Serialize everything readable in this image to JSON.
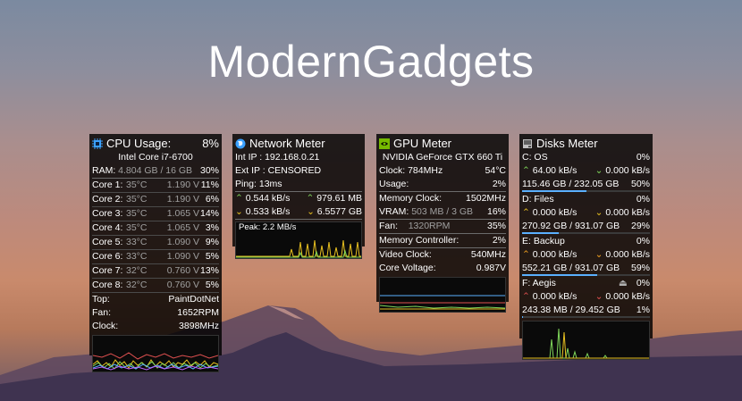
{
  "title": "ModernGadgets",
  "cpu": {
    "header": "CPU Usage:",
    "usage": "8%",
    "model": "Intel Core i7-6700",
    "ram_label": "RAM:",
    "ram_value": "4.804 GB / 16 GB",
    "ram_pct": "30%",
    "cores": [
      {
        "name": "Core 1:",
        "temp": "35°C",
        "volt": "1.190 V",
        "pct": "11%"
      },
      {
        "name": "Core 2:",
        "temp": "35°C",
        "volt": "1.190 V",
        "pct": "6%"
      },
      {
        "name": "Core 3:",
        "temp": "35°C",
        "volt": "1.065 V",
        "pct": "14%"
      },
      {
        "name": "Core 4:",
        "temp": "35°C",
        "volt": "1.065 V",
        "pct": "3%"
      },
      {
        "name": "Core 5:",
        "temp": "33°C",
        "volt": "1.090 V",
        "pct": "9%"
      },
      {
        "name": "Core 6:",
        "temp": "33°C",
        "volt": "1.090 V",
        "pct": "5%"
      },
      {
        "name": "Core 7:",
        "temp": "32°C",
        "volt": "0.760 V",
        "pct": "13%"
      },
      {
        "name": "Core 8:",
        "temp": "32°C",
        "volt": "0.760 V",
        "pct": "5%"
      }
    ],
    "top_label": "Top:",
    "top_value": "PaintDotNet",
    "fan_label": "Fan:",
    "fan_value": "1652RPM",
    "clock_label": "Clock:",
    "clock_value": "3898MHz"
  },
  "network": {
    "header": "Network Meter",
    "int_ip": "Int IP : 192.168.0.21",
    "ext_ip": "Ext IP : CENSORED",
    "ping": "Ping: 13ms",
    "up_rate": "0.544 kB/s",
    "up_total": "979.61 MB",
    "down_rate": "0.533 kB/s",
    "down_total": "6.5577 GB",
    "peak": "Peak: 2.2 MB/s"
  },
  "gpu": {
    "header": "GPU Meter",
    "model": "NVIDIA GeForce GTX 660 Ti",
    "clock_label": "Clock: 784MHz",
    "temp": "54°C",
    "usage_label": "Usage:",
    "usage_value": "2%",
    "mem_clock_label": "Memory Clock:",
    "mem_clock_value": "1502MHz",
    "vram_label": "VRAM:",
    "vram_value": "503 MB / 3 GB",
    "vram_pct": "16%",
    "fan_label": "Fan:",
    "fan_value": "1320RPM",
    "fan_pct": "35%",
    "mem_ctrl_label": "Memory Controller:",
    "mem_ctrl_value": "2%",
    "video_clock_label": "Video Clock:",
    "video_clock_value": "540MHz",
    "core_volt_label": "Core Voltage:",
    "core_volt_value": "0.987V"
  },
  "disks": {
    "header": "Disks Meter",
    "drives": [
      {
        "name": "C: OS",
        "pct": "0%",
        "read": "64.00 kB/s",
        "write": "0.000 kB/s",
        "space": "115.46 GB / 232.05 GB",
        "used": "50%",
        "fill": 0.5,
        "color": "#7fd65a"
      },
      {
        "name": "D: Files",
        "pct": "0%",
        "read": "0.000 kB/s",
        "write": "0.000 kB/s",
        "space": "270.92 GB / 931.07 GB",
        "used": "29%",
        "fill": 0.29,
        "color": "#e8c020"
      },
      {
        "name": "E: Backup",
        "pct": "0%",
        "read": "0.000 kB/s",
        "write": "0.000 kB/s",
        "space": "552.21 GB / 931.07 GB",
        "used": "59%",
        "fill": 0.59,
        "color": "#f0a020"
      },
      {
        "name": "F: Aegis",
        "pct": "0%",
        "read": "0.000 kB/s",
        "write": "0.000 kB/s",
        "space": "243.38 MB / 29.452 GB",
        "used": "1%",
        "fill": 0.01,
        "color": "#e05050"
      }
    ]
  },
  "colors": {
    "up": "#7fd65a",
    "down": "#e8c020",
    "graph_bg": "#0a0a0a"
  },
  "icons": [
    "cpu-chip-icon",
    "globe-icon",
    "nvidia-icon",
    "disk-icon",
    "eject-icon",
    "arrow-up-icon",
    "arrow-down-icon"
  ]
}
